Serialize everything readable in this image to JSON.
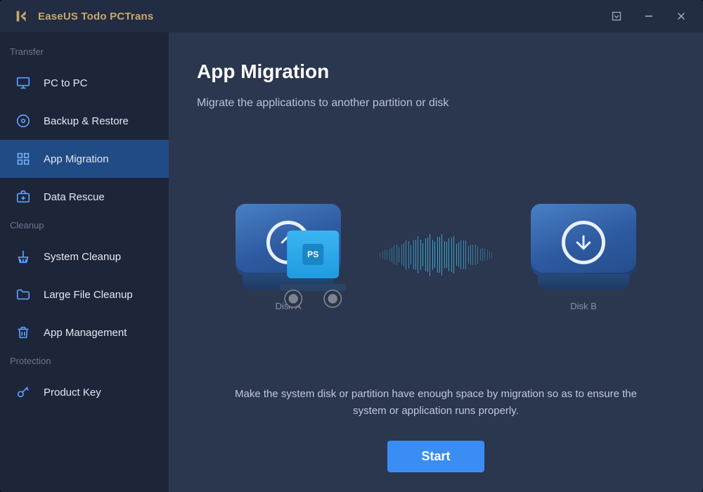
{
  "app": {
    "title": "EaseUS Todo PCTrans"
  },
  "window_controls": {
    "dropdown": "▾",
    "minimize": "—",
    "close": "✕"
  },
  "sidebar": {
    "sections": [
      {
        "label": "Transfer",
        "items": [
          {
            "id": "pc-to-pc",
            "label": "PC to PC",
            "icon": "monitor",
            "active": false
          },
          {
            "id": "backup-restore",
            "label": "Backup & Restore",
            "icon": "disc",
            "active": false
          },
          {
            "id": "app-migration",
            "label": "App Migration",
            "icon": "grid",
            "active": true
          },
          {
            "id": "data-rescue",
            "label": "Data Rescue",
            "icon": "medkit",
            "active": false
          }
        ]
      },
      {
        "label": "Cleanup",
        "items": [
          {
            "id": "system-cleanup",
            "label": "System Cleanup",
            "icon": "broom",
            "active": false
          },
          {
            "id": "large-file-cleanup",
            "label": "Large File Cleanup",
            "icon": "folder",
            "active": false
          },
          {
            "id": "app-management",
            "label": "App Management",
            "icon": "trash",
            "active": false
          }
        ]
      },
      {
        "label": "Protection",
        "items": [
          {
            "id": "product-key",
            "label": "Product Key",
            "icon": "key",
            "active": false
          }
        ]
      }
    ]
  },
  "main": {
    "title": "App Migration",
    "subtitle": "Migrate the applications to another partition or disk",
    "source_label": "Disk A",
    "target_label": "Disk B",
    "box_label": "PS",
    "description": "Make the system disk or partition have enough space by migration so as to ensure the system or application runs properly.",
    "start_label": "Start"
  }
}
